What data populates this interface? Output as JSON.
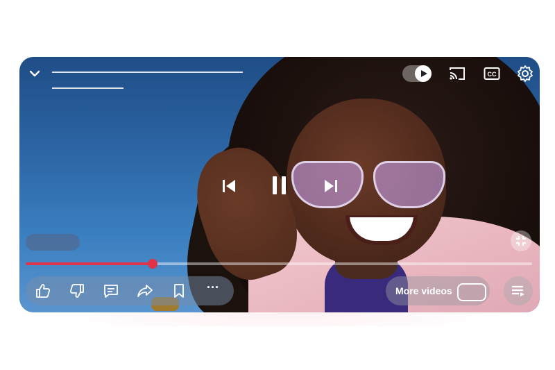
{
  "player": {
    "top_bar": {
      "collapse_icon": "chevron-down-icon",
      "autoplay_icon": "play-icon",
      "cast_icon": "cast-icon",
      "captions_icon": "closed-captions-icon",
      "settings_icon": "gear-icon"
    },
    "center_controls": {
      "previous_icon": "skip-previous-icon",
      "pause_icon": "pause-icon",
      "next_icon": "skip-next-icon"
    },
    "progress": {
      "played_fraction": 0.25
    },
    "fullscreen_icon": "exit-fullscreen-icon",
    "actions": {
      "like_icon": "thumbs-up-icon",
      "dislike_icon": "thumbs-down-icon",
      "comment_icon": "comment-icon",
      "share_icon": "share-icon",
      "save_icon": "bookmark-icon",
      "more_label": "···"
    },
    "more_videos_label": "More videos",
    "queue_icon": "playlist-icon"
  },
  "colors": {
    "progress_played": "#e0334a",
    "background_top": "#1f4d86"
  }
}
